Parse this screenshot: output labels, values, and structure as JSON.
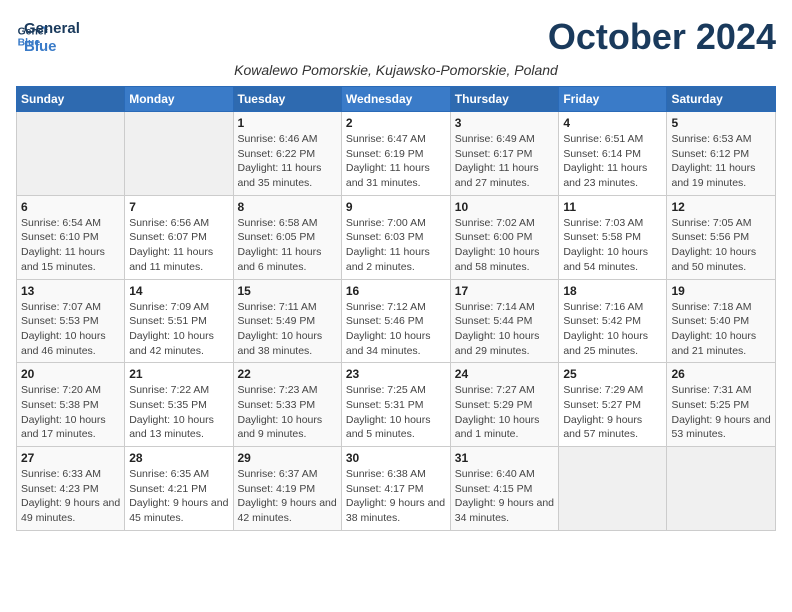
{
  "header": {
    "logo_line1": "General",
    "logo_line2": "Blue",
    "month_title": "October 2024",
    "subtitle": "Kowalewo Pomorskie, Kujawsko-Pomorskie, Poland"
  },
  "weekdays": [
    "Sunday",
    "Monday",
    "Tuesday",
    "Wednesday",
    "Thursday",
    "Friday",
    "Saturday"
  ],
  "weeks": [
    [
      {
        "day": "",
        "sunrise": "",
        "sunset": "",
        "daylight": ""
      },
      {
        "day": "",
        "sunrise": "",
        "sunset": "",
        "daylight": ""
      },
      {
        "day": "1",
        "sunrise": "Sunrise: 6:46 AM",
        "sunset": "Sunset: 6:22 PM",
        "daylight": "Daylight: 11 hours and 35 minutes."
      },
      {
        "day": "2",
        "sunrise": "Sunrise: 6:47 AM",
        "sunset": "Sunset: 6:19 PM",
        "daylight": "Daylight: 11 hours and 31 minutes."
      },
      {
        "day": "3",
        "sunrise": "Sunrise: 6:49 AM",
        "sunset": "Sunset: 6:17 PM",
        "daylight": "Daylight: 11 hours and 27 minutes."
      },
      {
        "day": "4",
        "sunrise": "Sunrise: 6:51 AM",
        "sunset": "Sunset: 6:14 PM",
        "daylight": "Daylight: 11 hours and 23 minutes."
      },
      {
        "day": "5",
        "sunrise": "Sunrise: 6:53 AM",
        "sunset": "Sunset: 6:12 PM",
        "daylight": "Daylight: 11 hours and 19 minutes."
      }
    ],
    [
      {
        "day": "6",
        "sunrise": "Sunrise: 6:54 AM",
        "sunset": "Sunset: 6:10 PM",
        "daylight": "Daylight: 11 hours and 15 minutes."
      },
      {
        "day": "7",
        "sunrise": "Sunrise: 6:56 AM",
        "sunset": "Sunset: 6:07 PM",
        "daylight": "Daylight: 11 hours and 11 minutes."
      },
      {
        "day": "8",
        "sunrise": "Sunrise: 6:58 AM",
        "sunset": "Sunset: 6:05 PM",
        "daylight": "Daylight: 11 hours and 6 minutes."
      },
      {
        "day": "9",
        "sunrise": "Sunrise: 7:00 AM",
        "sunset": "Sunset: 6:03 PM",
        "daylight": "Daylight: 11 hours and 2 minutes."
      },
      {
        "day": "10",
        "sunrise": "Sunrise: 7:02 AM",
        "sunset": "Sunset: 6:00 PM",
        "daylight": "Daylight: 10 hours and 58 minutes."
      },
      {
        "day": "11",
        "sunrise": "Sunrise: 7:03 AM",
        "sunset": "Sunset: 5:58 PM",
        "daylight": "Daylight: 10 hours and 54 minutes."
      },
      {
        "day": "12",
        "sunrise": "Sunrise: 7:05 AM",
        "sunset": "Sunset: 5:56 PM",
        "daylight": "Daylight: 10 hours and 50 minutes."
      }
    ],
    [
      {
        "day": "13",
        "sunrise": "Sunrise: 7:07 AM",
        "sunset": "Sunset: 5:53 PM",
        "daylight": "Daylight: 10 hours and 46 minutes."
      },
      {
        "day": "14",
        "sunrise": "Sunrise: 7:09 AM",
        "sunset": "Sunset: 5:51 PM",
        "daylight": "Daylight: 10 hours and 42 minutes."
      },
      {
        "day": "15",
        "sunrise": "Sunrise: 7:11 AM",
        "sunset": "Sunset: 5:49 PM",
        "daylight": "Daylight: 10 hours and 38 minutes."
      },
      {
        "day": "16",
        "sunrise": "Sunrise: 7:12 AM",
        "sunset": "Sunset: 5:46 PM",
        "daylight": "Daylight: 10 hours and 34 minutes."
      },
      {
        "day": "17",
        "sunrise": "Sunrise: 7:14 AM",
        "sunset": "Sunset: 5:44 PM",
        "daylight": "Daylight: 10 hours and 29 minutes."
      },
      {
        "day": "18",
        "sunrise": "Sunrise: 7:16 AM",
        "sunset": "Sunset: 5:42 PM",
        "daylight": "Daylight: 10 hours and 25 minutes."
      },
      {
        "day": "19",
        "sunrise": "Sunrise: 7:18 AM",
        "sunset": "Sunset: 5:40 PM",
        "daylight": "Daylight: 10 hours and 21 minutes."
      }
    ],
    [
      {
        "day": "20",
        "sunrise": "Sunrise: 7:20 AM",
        "sunset": "Sunset: 5:38 PM",
        "daylight": "Daylight: 10 hours and 17 minutes."
      },
      {
        "day": "21",
        "sunrise": "Sunrise: 7:22 AM",
        "sunset": "Sunset: 5:35 PM",
        "daylight": "Daylight: 10 hours and 13 minutes."
      },
      {
        "day": "22",
        "sunrise": "Sunrise: 7:23 AM",
        "sunset": "Sunset: 5:33 PM",
        "daylight": "Daylight: 10 hours and 9 minutes."
      },
      {
        "day": "23",
        "sunrise": "Sunrise: 7:25 AM",
        "sunset": "Sunset: 5:31 PM",
        "daylight": "Daylight: 10 hours and 5 minutes."
      },
      {
        "day": "24",
        "sunrise": "Sunrise: 7:27 AM",
        "sunset": "Sunset: 5:29 PM",
        "daylight": "Daylight: 10 hours and 1 minute."
      },
      {
        "day": "25",
        "sunrise": "Sunrise: 7:29 AM",
        "sunset": "Sunset: 5:27 PM",
        "daylight": "Daylight: 9 hours and 57 minutes."
      },
      {
        "day": "26",
        "sunrise": "Sunrise: 7:31 AM",
        "sunset": "Sunset: 5:25 PM",
        "daylight": "Daylight: 9 hours and 53 minutes."
      }
    ],
    [
      {
        "day": "27",
        "sunrise": "Sunrise: 6:33 AM",
        "sunset": "Sunset: 4:23 PM",
        "daylight": "Daylight: 9 hours and 49 minutes."
      },
      {
        "day": "28",
        "sunrise": "Sunrise: 6:35 AM",
        "sunset": "Sunset: 4:21 PM",
        "daylight": "Daylight: 9 hours and 45 minutes."
      },
      {
        "day": "29",
        "sunrise": "Sunrise: 6:37 AM",
        "sunset": "Sunset: 4:19 PM",
        "daylight": "Daylight: 9 hours and 42 minutes."
      },
      {
        "day": "30",
        "sunrise": "Sunrise: 6:38 AM",
        "sunset": "Sunset: 4:17 PM",
        "daylight": "Daylight: 9 hours and 38 minutes."
      },
      {
        "day": "31",
        "sunrise": "Sunrise: 6:40 AM",
        "sunset": "Sunset: 4:15 PM",
        "daylight": "Daylight: 9 hours and 34 minutes."
      },
      {
        "day": "",
        "sunrise": "",
        "sunset": "",
        "daylight": ""
      },
      {
        "day": "",
        "sunrise": "",
        "sunset": "",
        "daylight": ""
      }
    ]
  ]
}
